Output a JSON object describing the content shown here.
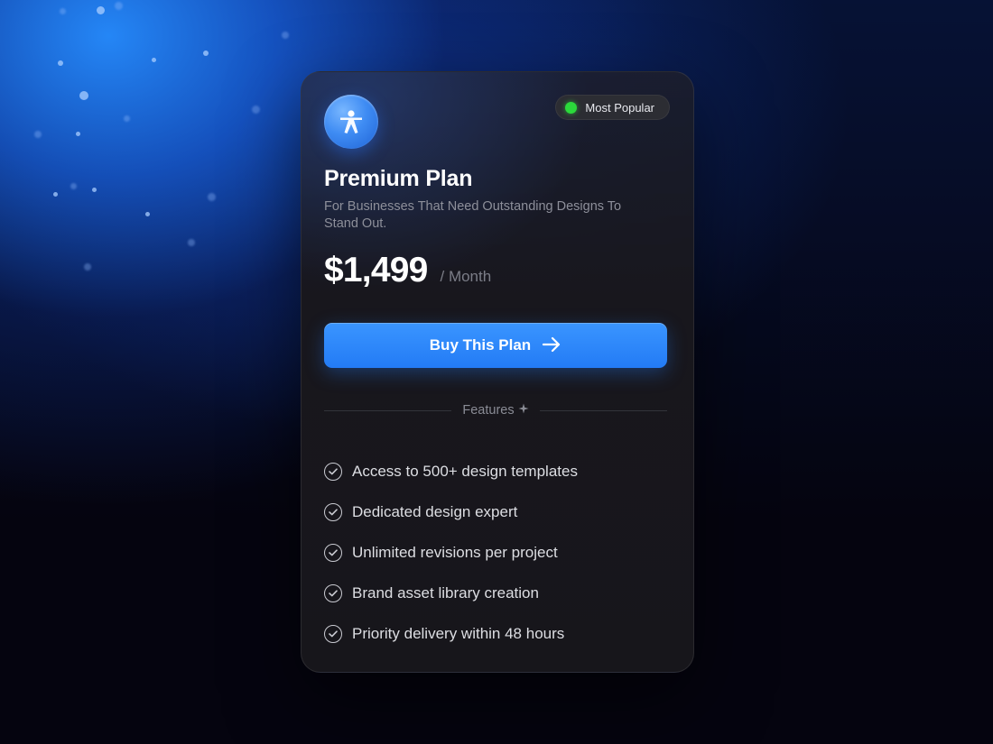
{
  "colors": {
    "accent": "#2F8BFA",
    "badge_dot": "#2BD93B",
    "card_bg": "#17161B",
    "page_bg": "#05040F"
  },
  "plan": {
    "logo_icon": "person-star-icon",
    "badge": {
      "label": "Most Popular",
      "status": "green-dot"
    },
    "title": "Premium Plan",
    "subtitle": "For Businesses That Need Outstanding Designs To Stand Out.",
    "price": "$1,499",
    "period": "/ Month",
    "cta": {
      "label": "Buy This Plan",
      "icon": "arrow-right-icon"
    }
  },
  "features": {
    "heading": "Features",
    "heading_icon": "sparkle-icon",
    "items": [
      {
        "label": "Access to 500+ design templates",
        "icon": "check-circle-icon"
      },
      {
        "label": "Dedicated design expert",
        "icon": "check-circle-icon"
      },
      {
        "label": "Unlimited revisions per project",
        "icon": "check-circle-icon"
      },
      {
        "label": "Brand asset library creation",
        "icon": "check-circle-icon"
      },
      {
        "label": "Priority delivery within 48 hours",
        "icon": "check-circle-icon"
      }
    ]
  }
}
